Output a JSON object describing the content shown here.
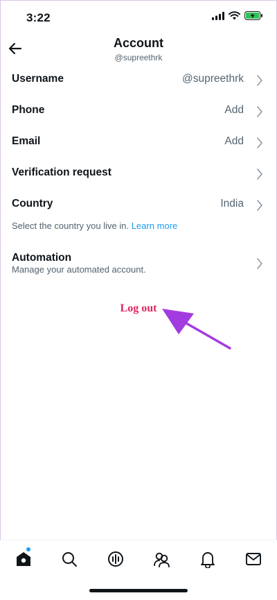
{
  "status_bar": {
    "time": "3:22"
  },
  "header": {
    "title": "Account",
    "subtitle": "@supreethrk"
  },
  "rows": [
    {
      "label": "Username",
      "value": "@supreethrk"
    },
    {
      "label": "Phone",
      "value": "Add"
    },
    {
      "label": "Email",
      "value": "Add"
    },
    {
      "label": "Verification request",
      "value": ""
    },
    {
      "label": "Country",
      "value": "India"
    }
  ],
  "country_helper": {
    "text": "Select the country you live in. ",
    "link": "Learn more"
  },
  "automation": {
    "label": "Automation",
    "description": "Manage your automated account."
  },
  "logout": {
    "label": "Log out"
  },
  "colors": {
    "accent": "#1d9bf0",
    "logout": "#e0245e",
    "annotation_arrow": "#a23be0",
    "secondary_text": "#536471"
  },
  "tab_bar": {
    "items": [
      "home-icon",
      "search-icon",
      "spaces-icon",
      "communities-icon",
      "notifications-icon",
      "messages-icon"
    ]
  }
}
